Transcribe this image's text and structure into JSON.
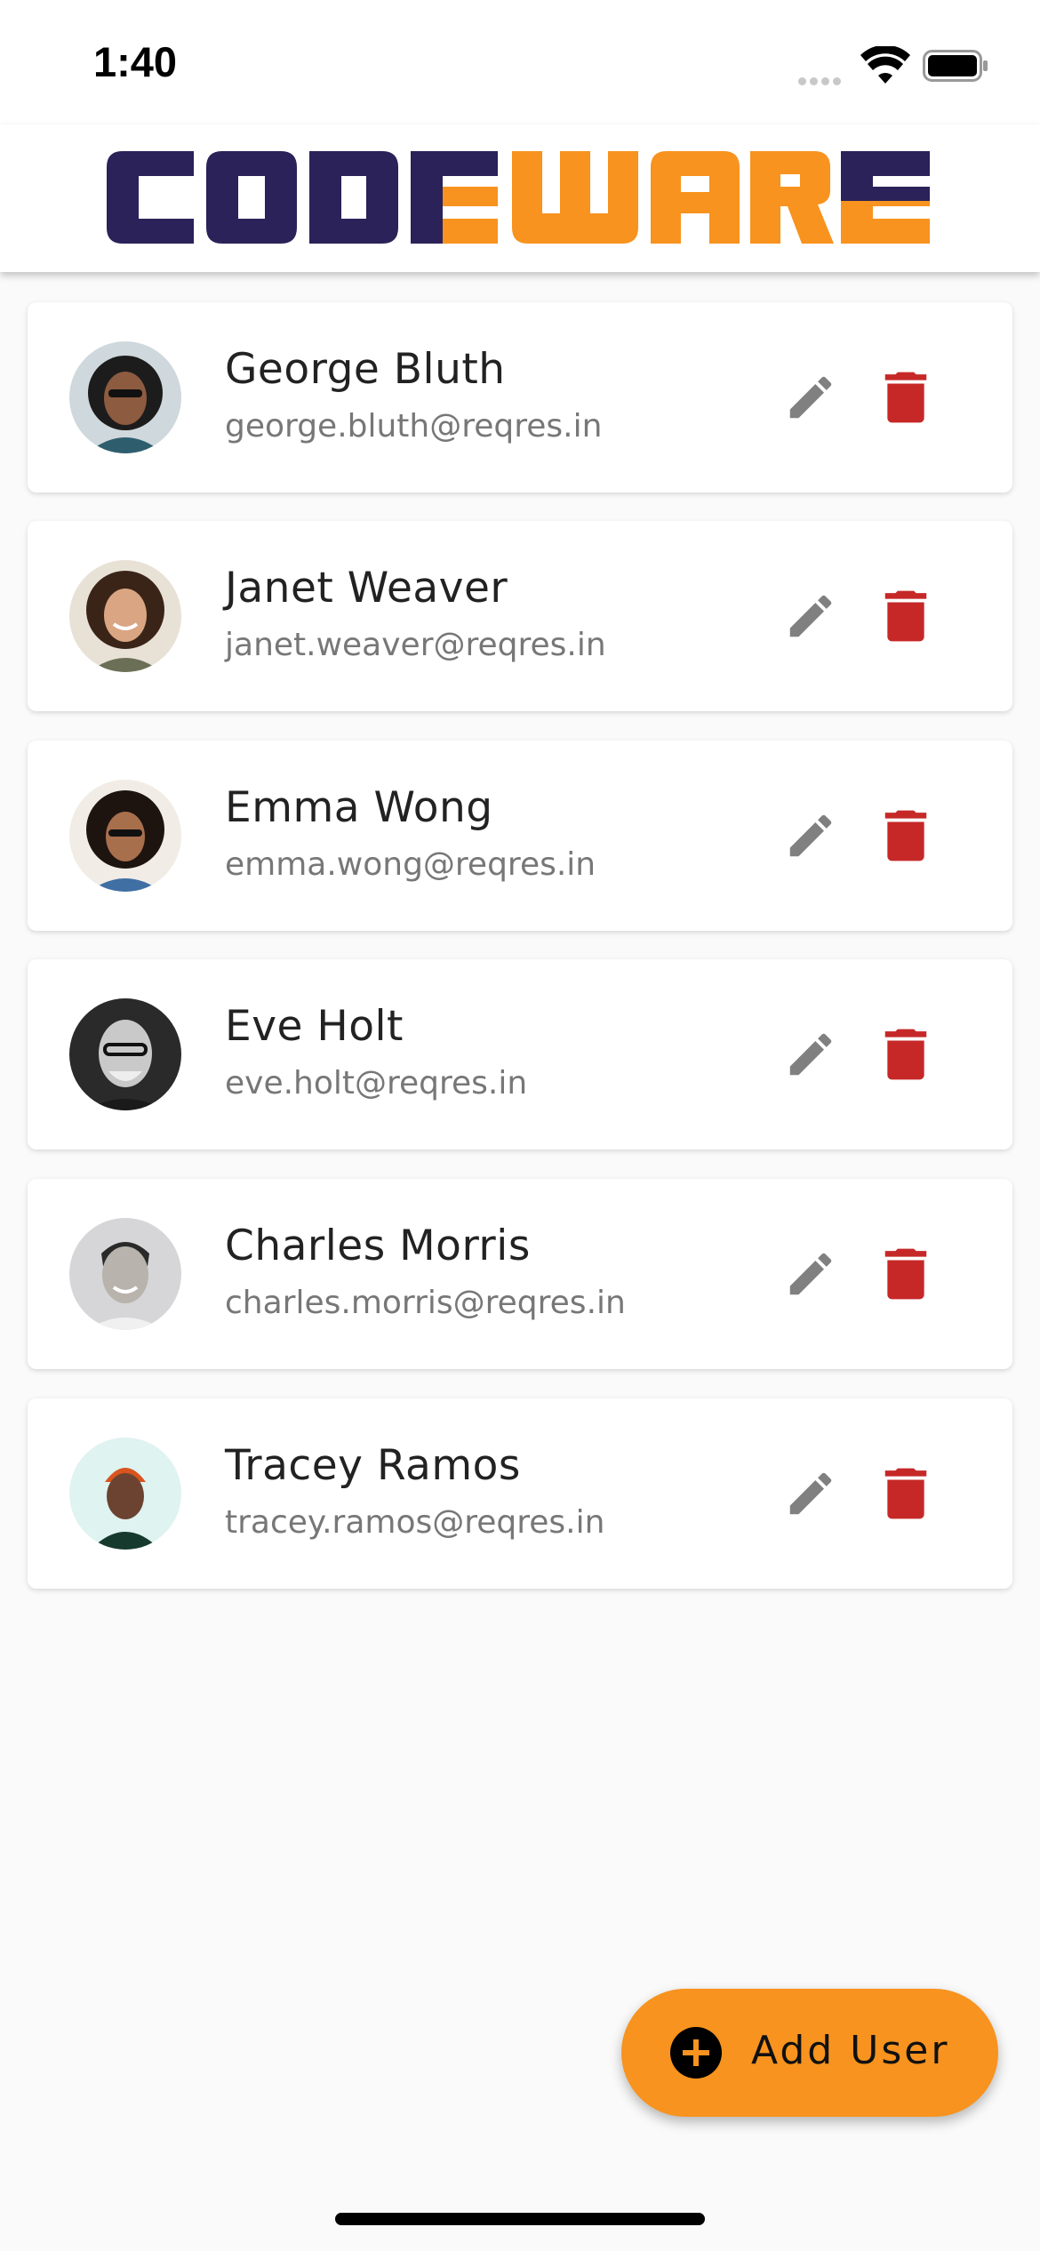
{
  "status_bar": {
    "time": "1:40"
  },
  "app_bar": {
    "logo_text_dark": "CODE",
    "logo_text_orange": "WARE",
    "logo_colors": {
      "dark": "#2b2259",
      "orange": "#f7931e"
    }
  },
  "users": [
    {
      "name": "George Bluth",
      "email": "george.bluth@reqres.in"
    },
    {
      "name": "Janet Weaver",
      "email": "janet.weaver@reqres.in"
    },
    {
      "name": "Emma Wong",
      "email": "emma.wong@reqres.in"
    },
    {
      "name": "Eve Holt",
      "email": "eve.holt@reqres.in"
    },
    {
      "name": "Charles Morris",
      "email": "charles.morris@reqres.in"
    },
    {
      "name": "Tracey Ramos",
      "email": "tracey.ramos@reqres.in"
    }
  ],
  "actions": {
    "edit_icon": "pencil-icon",
    "delete_icon": "trash-icon",
    "edit_color": "#808080",
    "delete_color": "#c62828"
  },
  "fab": {
    "label": "Add User",
    "icon": "plus-circle-icon",
    "color": "#f7931e"
  }
}
